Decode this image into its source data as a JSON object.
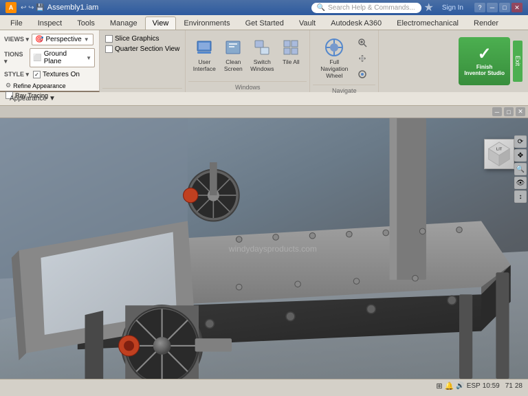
{
  "titlebar": {
    "app_title": "Assembly1.iam",
    "search_placeholder": "Search Help & Commands...",
    "sign_in_label": "Sign In",
    "question_mark": "?",
    "minimize": "─",
    "maximize": "□",
    "close": "✕"
  },
  "ribbon_tabs": [
    {
      "label": "File",
      "active": false
    },
    {
      "label": "Inspect",
      "active": false
    },
    {
      "label": "Tools",
      "active": false
    },
    {
      "label": "Manage",
      "active": false
    },
    {
      "label": "View",
      "active": true
    },
    {
      "label": "Environments",
      "active": false
    },
    {
      "label": "Get Started",
      "active": false
    },
    {
      "label": "Vault",
      "active": false
    },
    {
      "label": "Autodesk A360",
      "active": false
    },
    {
      "label": "Electromechanical",
      "active": false
    },
    {
      "label": "Render",
      "active": false
    }
  ],
  "ribbon": {
    "left_section": {
      "perspective_label": "Perspective",
      "ground_plane_label": "Ground Plane",
      "style_label": "Style",
      "textures_on_label": "Textures On",
      "refine_label": "Refine Appearance",
      "ray_tracing_label": "Ray Tracing"
    },
    "slice_graphics": {
      "label": "Slice Graphics"
    },
    "quarter_section": {
      "label": "Quarter Section View"
    },
    "windows_group": {
      "label": "Windows",
      "user_interface": "User Interface",
      "clean_screen": "Clean Screen",
      "switch_windows": "Switch Windows",
      "tile_all": "Tile All"
    },
    "navigate_group": {
      "label": "Navigate",
      "full_nav_wheel": "Full Navigation Wheel"
    },
    "finish_btn": {
      "label": "Finish\nInventor Studio",
      "check": "✓"
    },
    "exit_label": "Exit"
  },
  "appearance_bar": {
    "label": "Appearance",
    "arrow": "▼"
  },
  "viewport": {
    "title": "",
    "watermark": "windydaysproducts.com"
  },
  "nav_cube": {
    "label": "LIT"
  },
  "status_bar": {
    "speaker_icon": "🔊",
    "language": "ESP",
    "time": "10:59",
    "num1": "71",
    "num2": "28"
  }
}
